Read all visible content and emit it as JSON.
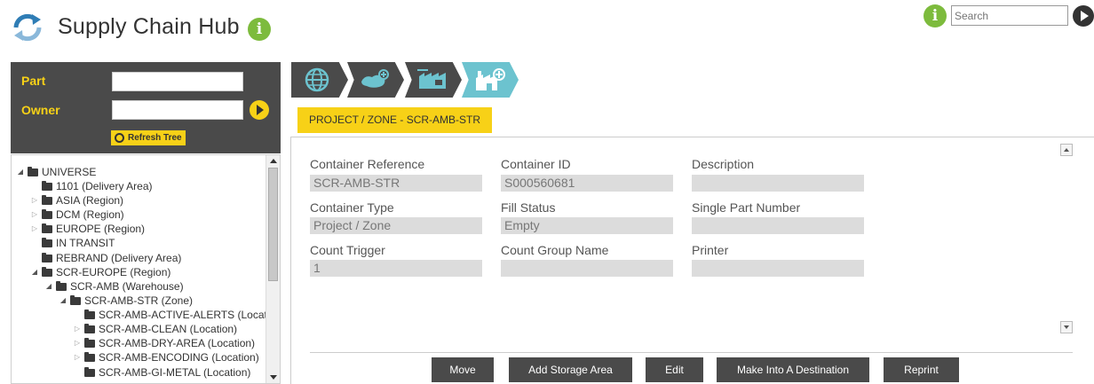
{
  "header": {
    "title": "Supply Chain Hub",
    "logo_icon": "sync-arrows-icon",
    "info_icon": "info-icon",
    "search_placeholder": "Search",
    "accent_color": "#7dbb3d"
  },
  "filters": {
    "part_label": "Part",
    "part_value": "",
    "owner_label": "Owner",
    "owner_value": "",
    "refresh_label": "Refresh Tree",
    "accent_color": "#f7d117"
  },
  "tree": {
    "nodes": [
      {
        "label": "UNIVERSE",
        "state": "expanded"
      },
      {
        "label": "1101 (Delivery Area)",
        "state": "leaf"
      },
      {
        "label": "ASIA (Region)",
        "state": "collapsed"
      },
      {
        "label": "DCM (Region)",
        "state": "collapsed"
      },
      {
        "label": "EUROPE (Region)",
        "state": "collapsed"
      },
      {
        "label": "IN TRANSIT",
        "state": "leaf"
      },
      {
        "label": "REBRAND (Delivery Area)",
        "state": "leaf"
      },
      {
        "label": "SCR-EUROPE (Region)",
        "state": "expanded"
      },
      {
        "label": "SCR-AMB (Warehouse)",
        "state": "expanded"
      },
      {
        "label": "SCR-AMB-STR (Zone)",
        "state": "expanded"
      },
      {
        "label": "SCR-AMB-ACTIVE-ALERTS (Locati",
        "state": "leaf"
      },
      {
        "label": "SCR-AMB-CLEAN (Location)",
        "state": "collapsed"
      },
      {
        "label": "SCR-AMB-DRY-AREA (Location)",
        "state": "collapsed"
      },
      {
        "label": "SCR-AMB-ENCODING (Location)",
        "state": "collapsed"
      },
      {
        "label": "SCR-AMB-GI-METAL (Location)",
        "state": "leaf"
      }
    ]
  },
  "breadcrumb": {
    "steps": [
      {
        "icon": "globe-icon",
        "active": false
      },
      {
        "icon": "region-map-icon",
        "active": false
      },
      {
        "icon": "warehouse-icon",
        "active": false
      },
      {
        "icon": "zone-factory-icon",
        "active": true
      }
    ],
    "active_color": "#6cc3cf"
  },
  "zone_tab": {
    "label": "PROJECT / ZONE - SCR-AMB-STR"
  },
  "details": {
    "container_reference": {
      "label": "Container Reference",
      "value": "SCR-AMB-STR"
    },
    "container_id": {
      "label": "Container ID",
      "value": "S000560681"
    },
    "description": {
      "label": "Description",
      "value": ""
    },
    "container_type": {
      "label": "Container Type",
      "value": "Project / Zone"
    },
    "fill_status": {
      "label": "Fill Status",
      "value": "Empty"
    },
    "single_part_number": {
      "label": "Single Part Number",
      "value": ""
    },
    "count_trigger": {
      "label": "Count Trigger",
      "value": "1"
    },
    "count_group_name": {
      "label": "Count Group Name",
      "value": ""
    },
    "printer": {
      "label": "Printer",
      "value": ""
    }
  },
  "actions": {
    "move": "Move",
    "add_storage_area": "Add Storage Area",
    "edit": "Edit",
    "make_destination": "Make Into A Destination",
    "reprint": "Reprint"
  }
}
